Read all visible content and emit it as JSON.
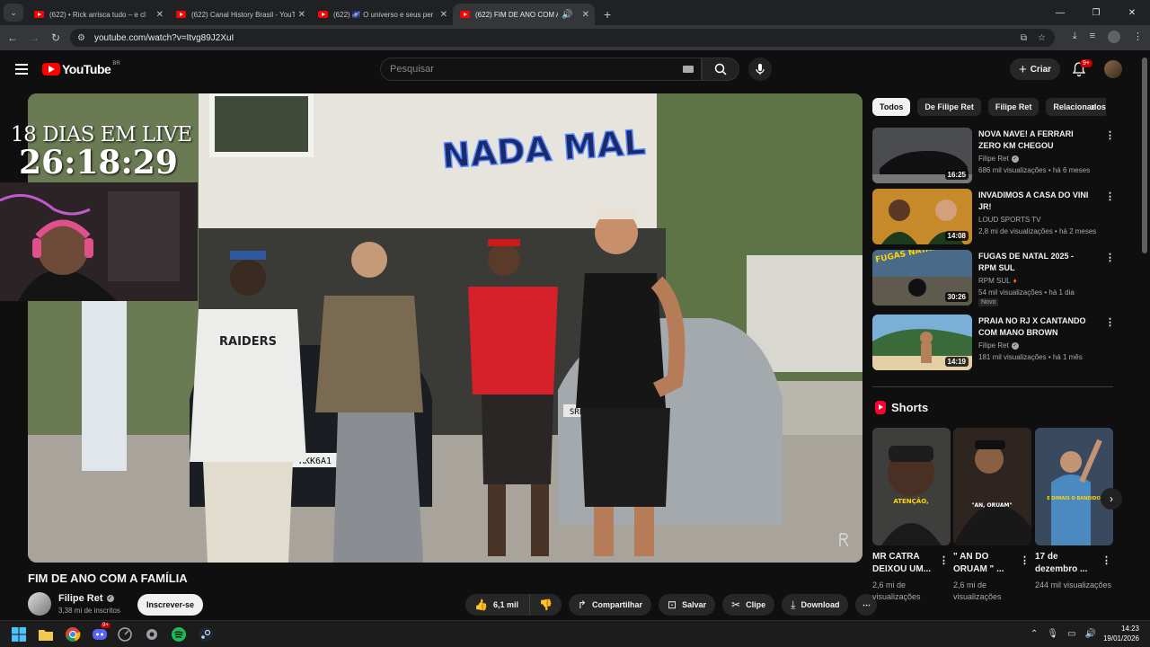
{
  "browser": {
    "tabs": [
      {
        "label": "(622) • Rick arrisca tudo – e cl",
        "active": false
      },
      {
        "label": "(622) Canal History Brasil - YouT",
        "active": false
      },
      {
        "label": "(622) 🌌 O universo e seus per",
        "active": false
      },
      {
        "label": "(622) FIM DE ANO COM A F",
        "active": true
      }
    ],
    "url": "youtube.com/watch?v=Itvg89J2XuI"
  },
  "youtube": {
    "logo_text": "YouTube",
    "country_code": "BR",
    "search_placeholder": "Pesquisar",
    "create_label": "Criar",
    "notif_badge": "9+"
  },
  "video": {
    "overlay_title": "18 DIAS EM LIVE",
    "overlay_timer": "26:18:29",
    "sign_text": "NADA MAL",
    "plate_text": "RKK6A1",
    "plate2_text": "SRL",
    "shirt_text": "RAIDERS",
    "title": "FIM DE ANO COM A FAMÍLIA",
    "channel": "Filipe Ret",
    "subscribers": "3,38 mi de inscritos",
    "subscribe_label": "Inscrever-se",
    "likes": "6,1 mil",
    "share_label": "Compartilhar",
    "save_label": "Salvar",
    "clip_label": "Clipe",
    "download_label": "Download"
  },
  "chips": [
    "Todos",
    "De Filipe Ret",
    "Filipe Ret",
    "Relacionados"
  ],
  "recommendations": [
    {
      "title": "NOVA NAVE! A FERRARI ZERO KM CHEGOU",
      "channel": "Filipe Ret",
      "meta": "686 mil visualizações • há 6 meses",
      "duration": "16:25"
    },
    {
      "title": "INVADIMOS A CASA DO VINI JR!",
      "channel": "LOUD SPORTS TV",
      "meta": "2,8 mi de visualizações • há 2 meses",
      "duration": "14:08"
    },
    {
      "title": "FUGAS DE NATAL 2025 - RPM SUL",
      "channel": "RPM SUL",
      "meta": "54 mil visualizações • há 1 dia",
      "duration": "30:26",
      "badge": "Novo",
      "thumb_text": "FUGAS NATALINAS"
    },
    {
      "title": "PRAIA NO RJ X CANTANDO COM MANO BROWN",
      "channel": "Filipe Ret",
      "meta": "181 mil visualizações • há 1 mês",
      "duration": "14:19"
    }
  ],
  "shorts": {
    "heading": "Shorts",
    "items": [
      {
        "title": "MR CATRA DEIXOU UM...",
        "views": "2,6 mi de visualizações",
        "caption": "ATENÇÃO,"
      },
      {
        "title": "\" AN DO ORUAM \" ...",
        "views": "2,6 mi de visualizações",
        "caption": "\"AN, ORUAM\""
      },
      {
        "title": "17 de dezembro ...",
        "views": "244 mil visualizações",
        "caption": "E DIMAIS O BANDIDO"
      }
    ]
  },
  "taskbar": {
    "time": "14:23",
    "date": "19/01/2026",
    "discord_badge": "9+"
  }
}
